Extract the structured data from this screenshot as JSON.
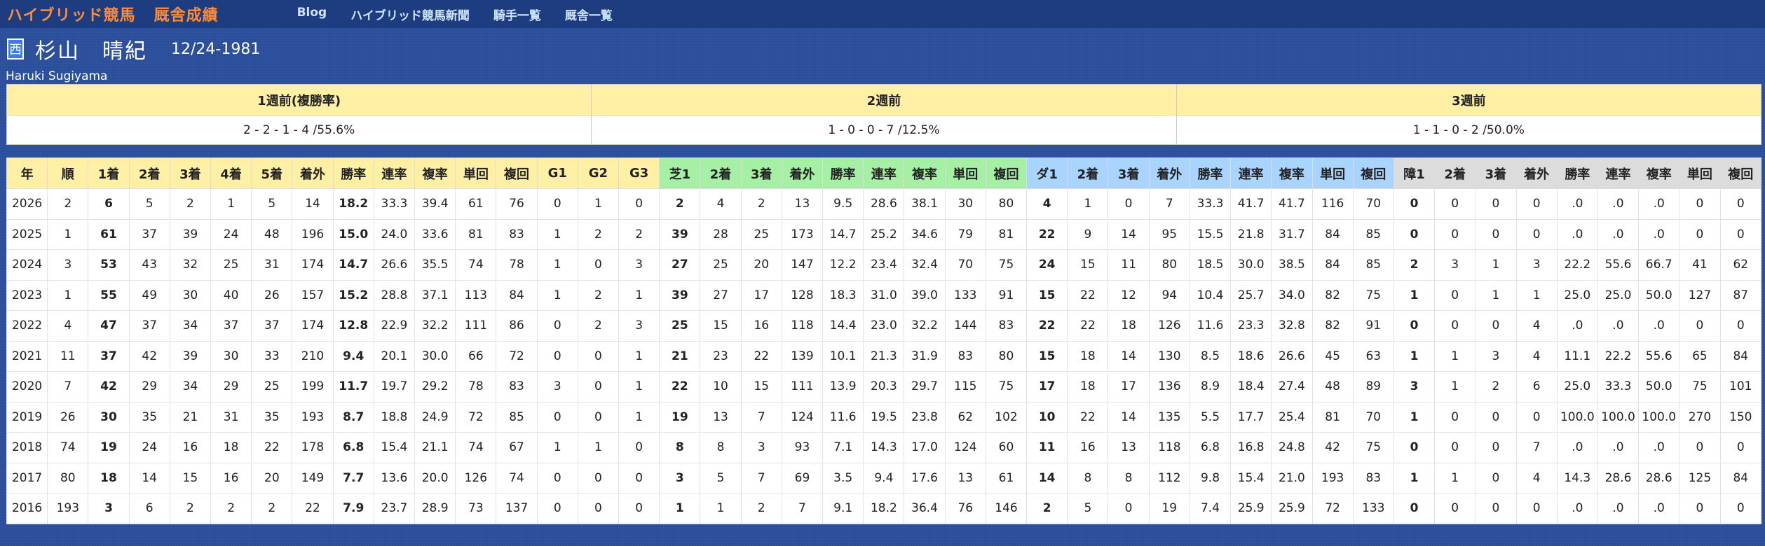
{
  "nav": {
    "brand": "ハイブリッド競馬",
    "section": "厩舎成績",
    "links": [
      "Blog",
      "ハイブリッド競馬新聞",
      "騎手一覧",
      "厩舎一覧"
    ]
  },
  "jockey": {
    "region": "西",
    "name": "杉山　晴紀",
    "birth": "12/24-1981",
    "roman": "Haruki Sugiyama"
  },
  "summary": {
    "headers": [
      "1週前(複勝率)",
      "2週前",
      "3週前"
    ],
    "values": [
      "2 - 2 - 1 - 4 /55.6%",
      "1 - 0 - 0 - 7 /12.5%",
      "1 - 1 - 0 - 2 /50.0%"
    ]
  },
  "colors": {
    "overall": "#fff0a6",
    "turf": "#a6f0a6",
    "dirt": "#a8d4ff",
    "steeple": "#dcdcdc"
  },
  "stats": {
    "headers": [
      "年",
      "順",
      "1着",
      "2着",
      "3着",
      "4着",
      "5着",
      "着外",
      "勝率",
      "連率",
      "複率",
      "単回",
      "複回",
      "G1",
      "G2",
      "G3",
      "芝1",
      "2着",
      "3着",
      "着外",
      "勝率",
      "連率",
      "複率",
      "単回",
      "複回",
      "ダ1",
      "2着",
      "3着",
      "着外",
      "勝率",
      "連率",
      "複率",
      "単回",
      "複回",
      "障1",
      "2着",
      "3着",
      "着外",
      "勝率",
      "連率",
      "複率",
      "単回",
      "複回"
    ],
    "rows": [
      [
        "2026",
        "2",
        "6",
        "5",
        "2",
        "1",
        "5",
        "14",
        "18.2",
        "33.3",
        "39.4",
        "61",
        "76",
        "0",
        "1",
        "0",
        "2",
        "4",
        "2",
        "13",
        "9.5",
        "28.6",
        "38.1",
        "30",
        "80",
        "4",
        "1",
        "0",
        "7",
        "33.3",
        "41.7",
        "41.7",
        "116",
        "70",
        "0",
        "0",
        "0",
        "0",
        ".0",
        ".0",
        ".0",
        "0",
        "0"
      ],
      [
        "2025",
        "1",
        "61",
        "37",
        "39",
        "24",
        "48",
        "196",
        "15.0",
        "24.0",
        "33.6",
        "81",
        "83",
        "1",
        "2",
        "2",
        "39",
        "28",
        "25",
        "173",
        "14.7",
        "25.2",
        "34.6",
        "79",
        "81",
        "22",
        "9",
        "14",
        "95",
        "15.5",
        "21.8",
        "31.7",
        "84",
        "85",
        "0",
        "0",
        "0",
        "0",
        ".0",
        ".0",
        ".0",
        "0",
        "0"
      ],
      [
        "2024",
        "3",
        "53",
        "43",
        "32",
        "25",
        "31",
        "174",
        "14.7",
        "26.6",
        "35.5",
        "74",
        "78",
        "1",
        "0",
        "3",
        "27",
        "25",
        "20",
        "147",
        "12.2",
        "23.4",
        "32.4",
        "70",
        "75",
        "24",
        "15",
        "11",
        "80",
        "18.5",
        "30.0",
        "38.5",
        "84",
        "85",
        "2",
        "3",
        "1",
        "3",
        "22.2",
        "55.6",
        "66.7",
        "41",
        "62"
      ],
      [
        "2023",
        "1",
        "55",
        "49",
        "30",
        "40",
        "26",
        "157",
        "15.2",
        "28.8",
        "37.1",
        "113",
        "84",
        "1",
        "2",
        "1",
        "39",
        "27",
        "17",
        "128",
        "18.3",
        "31.0",
        "39.0",
        "133",
        "91",
        "15",
        "22",
        "12",
        "94",
        "10.4",
        "25.7",
        "34.0",
        "82",
        "75",
        "1",
        "0",
        "1",
        "1",
        "25.0",
        "25.0",
        "50.0",
        "127",
        "87"
      ],
      [
        "2022",
        "4",
        "47",
        "37",
        "34",
        "37",
        "37",
        "174",
        "12.8",
        "22.9",
        "32.2",
        "111",
        "86",
        "0",
        "2",
        "3",
        "25",
        "15",
        "16",
        "118",
        "14.4",
        "23.0",
        "32.2",
        "144",
        "83",
        "22",
        "22",
        "18",
        "126",
        "11.6",
        "23.3",
        "32.8",
        "82",
        "91",
        "0",
        "0",
        "0",
        "4",
        ".0",
        ".0",
        ".0",
        "0",
        "0"
      ],
      [
        "2021",
        "11",
        "37",
        "42",
        "39",
        "30",
        "33",
        "210",
        "9.4",
        "20.1",
        "30.0",
        "66",
        "72",
        "0",
        "0",
        "1",
        "21",
        "23",
        "22",
        "139",
        "10.1",
        "21.3",
        "31.9",
        "83",
        "80",
        "15",
        "18",
        "14",
        "130",
        "8.5",
        "18.6",
        "26.6",
        "45",
        "63",
        "1",
        "1",
        "3",
        "4",
        "11.1",
        "22.2",
        "55.6",
        "65",
        "84"
      ],
      [
        "2020",
        "7",
        "42",
        "29",
        "34",
        "29",
        "25",
        "199",
        "11.7",
        "19.7",
        "29.2",
        "78",
        "83",
        "3",
        "0",
        "1",
        "22",
        "10",
        "15",
        "111",
        "13.9",
        "20.3",
        "29.7",
        "115",
        "75",
        "17",
        "18",
        "17",
        "136",
        "8.9",
        "18.4",
        "27.4",
        "48",
        "89",
        "3",
        "1",
        "2",
        "6",
        "25.0",
        "33.3",
        "50.0",
        "75",
        "101"
      ],
      [
        "2019",
        "26",
        "30",
        "35",
        "21",
        "31",
        "35",
        "193",
        "8.7",
        "18.8",
        "24.9",
        "72",
        "85",
        "0",
        "0",
        "1",
        "19",
        "13",
        "7",
        "124",
        "11.6",
        "19.5",
        "23.8",
        "62",
        "102",
        "10",
        "22",
        "14",
        "135",
        "5.5",
        "17.7",
        "25.4",
        "81",
        "70",
        "1",
        "0",
        "0",
        "0",
        "100.0",
        "100.0",
        "100.0",
        "270",
        "150"
      ],
      [
        "2018",
        "74",
        "19",
        "24",
        "16",
        "18",
        "22",
        "178",
        "6.8",
        "15.4",
        "21.1",
        "74",
        "67",
        "1",
        "1",
        "0",
        "8",
        "8",
        "3",
        "93",
        "7.1",
        "14.3",
        "17.0",
        "124",
        "60",
        "11",
        "16",
        "13",
        "118",
        "6.8",
        "16.8",
        "24.8",
        "42",
        "75",
        "0",
        "0",
        "0",
        "7",
        ".0",
        ".0",
        ".0",
        "0",
        "0"
      ],
      [
        "2017",
        "80",
        "18",
        "14",
        "15",
        "16",
        "20",
        "149",
        "7.7",
        "13.6",
        "20.0",
        "126",
        "74",
        "0",
        "0",
        "0",
        "3",
        "5",
        "7",
        "69",
        "3.5",
        "9.4",
        "17.6",
        "13",
        "61",
        "14",
        "8",
        "8",
        "112",
        "9.8",
        "15.4",
        "21.0",
        "193",
        "83",
        "1",
        "1",
        "0",
        "4",
        "14.3",
        "28.6",
        "28.6",
        "125",
        "84"
      ],
      [
        "2016",
        "193",
        "3",
        "6",
        "2",
        "2",
        "2",
        "22",
        "7.9",
        "23.7",
        "28.9",
        "73",
        "137",
        "0",
        "0",
        "0",
        "1",
        "1",
        "2",
        "7",
        "9.1",
        "18.2",
        "36.4",
        "76",
        "146",
        "2",
        "5",
        "0",
        "19",
        "7.4",
        "25.9",
        "25.9",
        "72",
        "133",
        "0",
        "0",
        "0",
        "0",
        ".0",
        ".0",
        ".0",
        "0",
        "0"
      ]
    ]
  }
}
